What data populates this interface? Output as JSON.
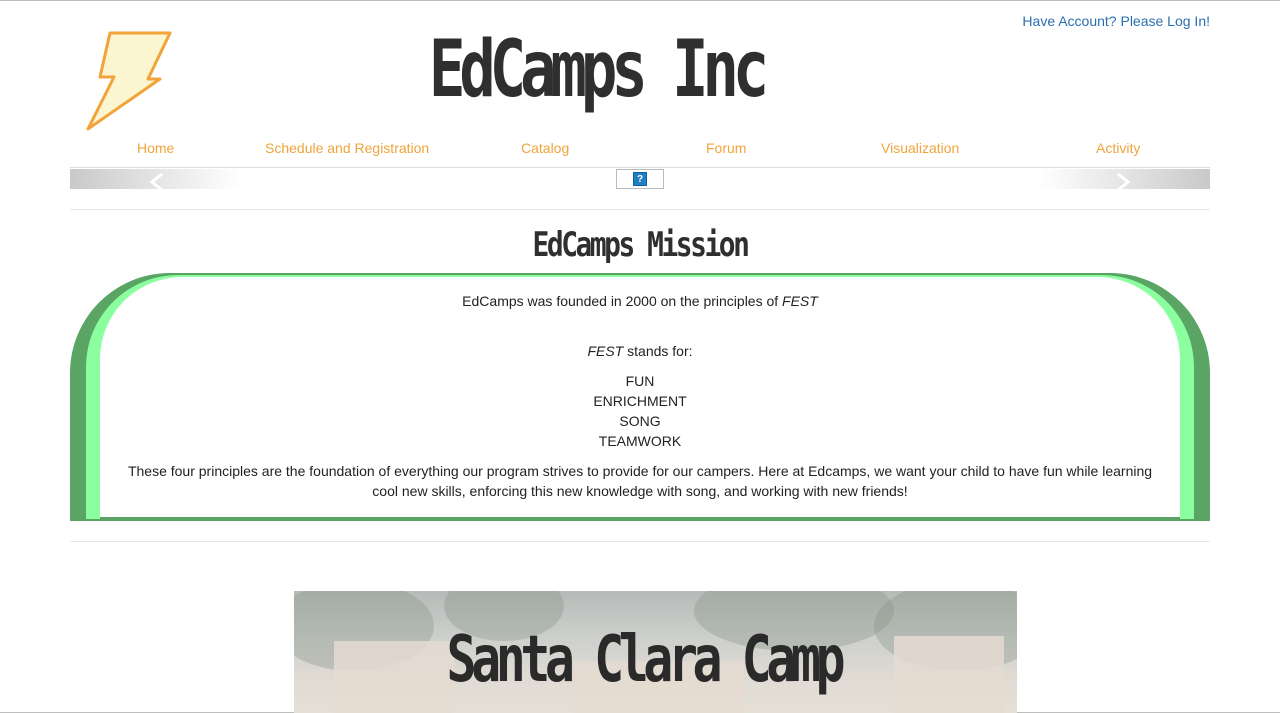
{
  "header": {
    "login_link": "Have Account? Please Log In!",
    "site_title": "EdCamps Inc",
    "logo_icon": "lightning-bolt-icon"
  },
  "nav": {
    "items": [
      {
        "label": "Home"
      },
      {
        "label": "Schedule and Registration"
      },
      {
        "label": "Catalog"
      },
      {
        "label": "Forum"
      },
      {
        "label": "Visualization"
      },
      {
        "label": "Activity"
      }
    ]
  },
  "slider": {
    "help_label": "?",
    "prev_icon": "chevron-left-icon",
    "next_icon": "chevron-right-icon"
  },
  "mission": {
    "title": "EdCamps Mission",
    "founded_text": "EdCamps was founded in 2000 on the principles of ",
    "founded_em": "FEST",
    "stands_em": "FEST",
    "stands_text": " stands for:",
    "principles": [
      "FUN",
      "ENRICHMENT",
      "SONG",
      "TEAMWORK"
    ],
    "description": "These four principles are the foundation of everything our program strives to provide for our campers. Here at Edcamps, we want your child to have fun while learning cool new skills, enforcing this new knowledge with song, and working with new friends!"
  },
  "camp": {
    "title": "Santa Clara Camp"
  },
  "colors": {
    "nav_link": "#f0a43a",
    "login_link": "#2a6fb0",
    "mission_outer": "#5aa564",
    "mission_mid": "#8bffa0"
  }
}
